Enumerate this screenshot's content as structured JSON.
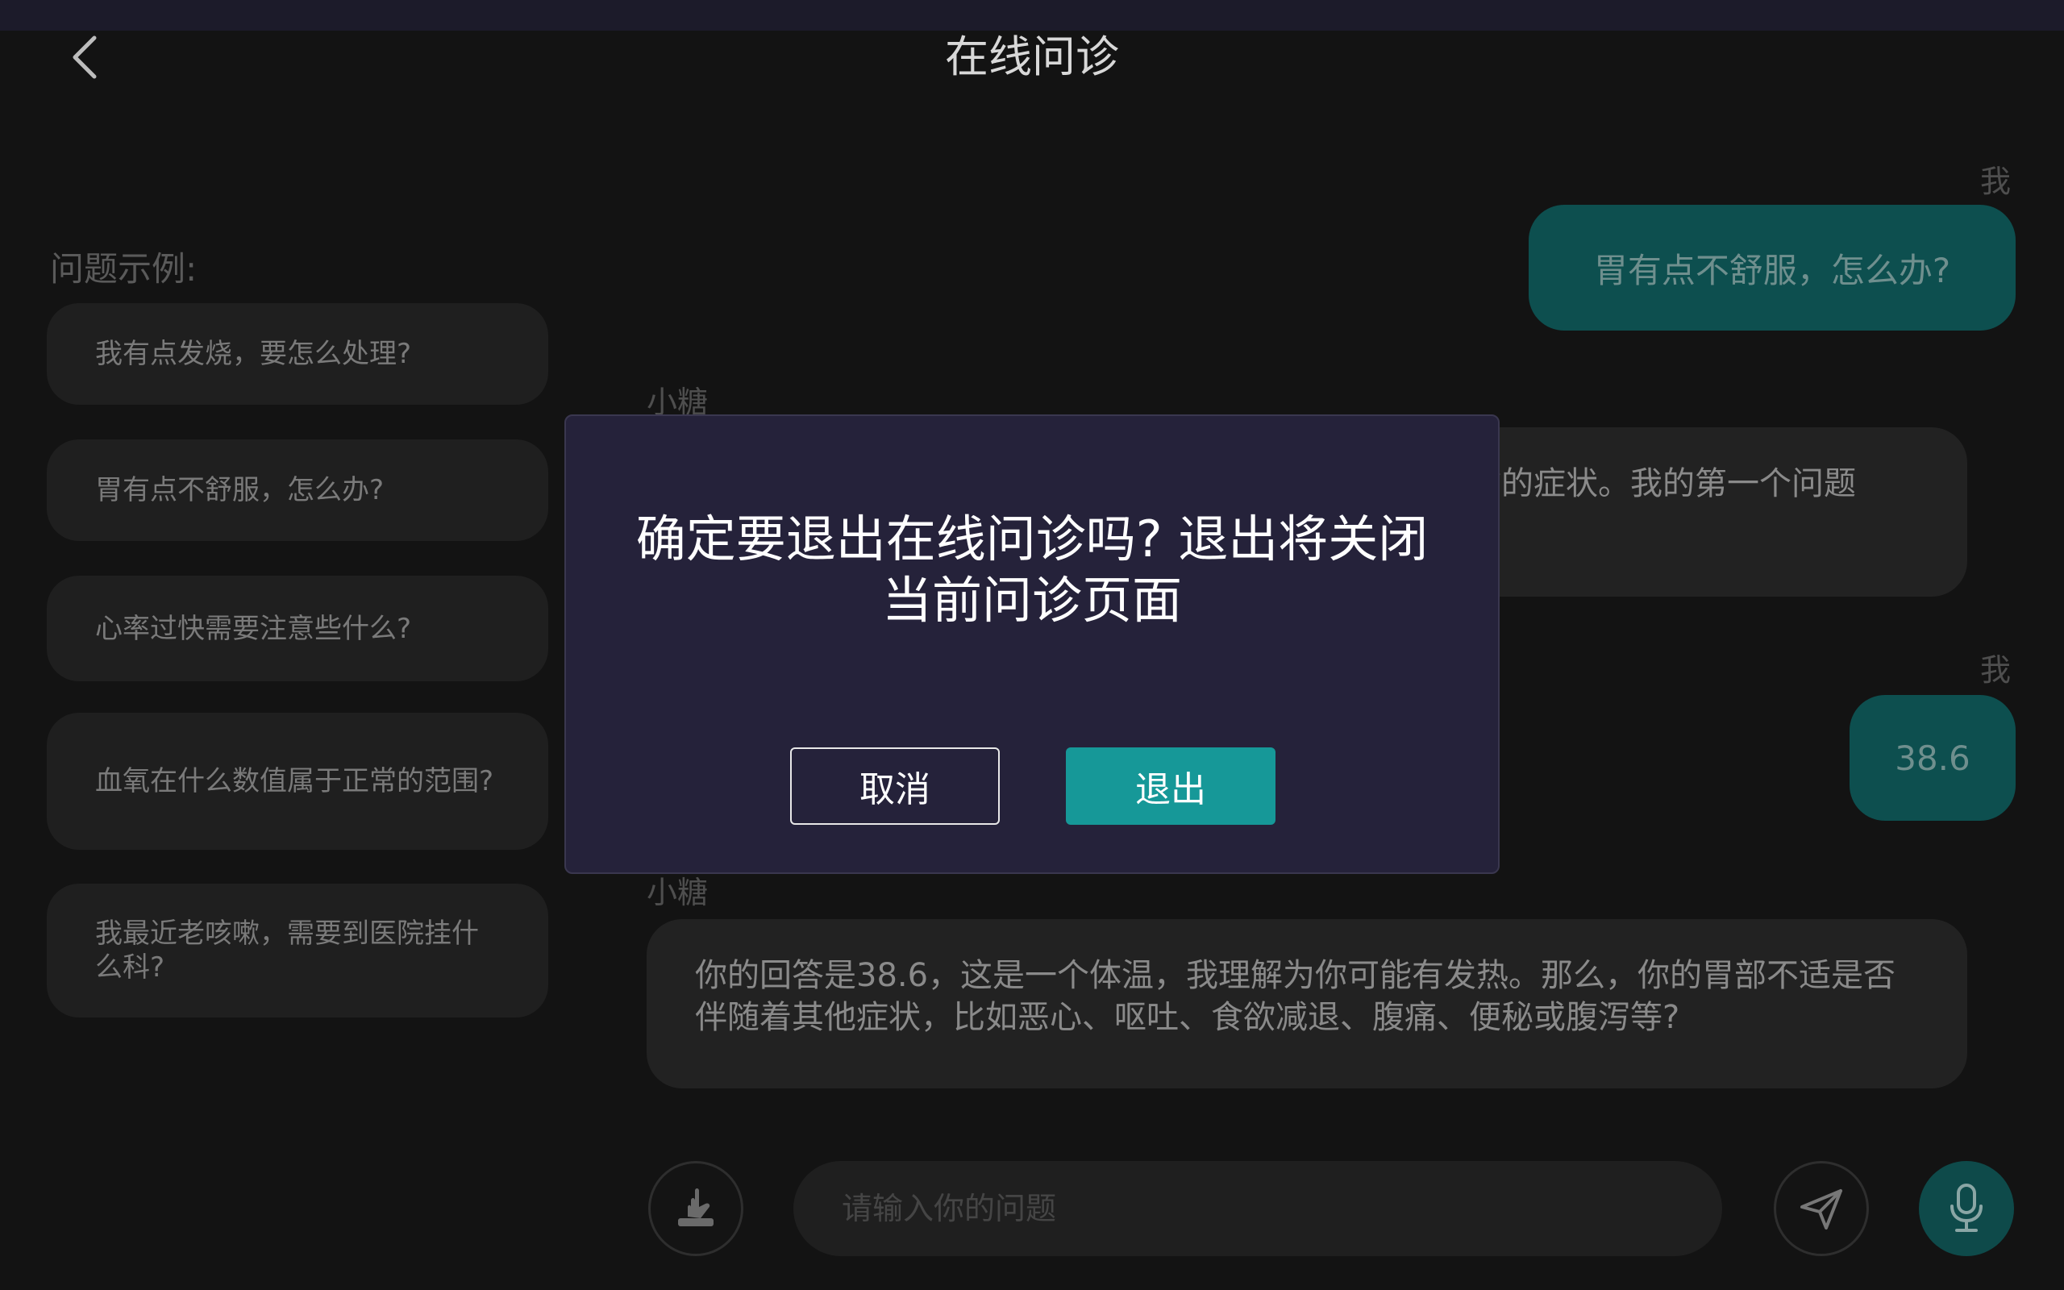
{
  "header": {
    "title": "在线问诊",
    "back_icon": "chevron-left-icon"
  },
  "examples": {
    "title": "问题示例:",
    "items": [
      "我有点发烧，要怎么处理?",
      "胃有点不舒服，怎么办?",
      "心率过快需要注意些什么?",
      "血氧在什么数值属于正常的范围?",
      "我最近老咳嗽，需要到医院挂什么科?"
    ]
  },
  "chat": {
    "me_label": "我",
    "bot_label": "小糖",
    "msg1_me": "胃有点不舒服，怎么办?",
    "msg2_bot": "首先，我需要了解一些更具体的信息以便更准确地判断你的症状。我的第一个问题是：你的体温是多少?",
    "msg3_me": "38.6",
    "msg4_bot": "你的回答是38.6，这是一个体温，我理解为你可能有发热。那么，你的胃部不适是否伴随着其他症状，比如恶心、呕吐、食欲减退、腹痛、便秘或腹泻等?"
  },
  "input": {
    "placeholder": "请输入你的问题",
    "left_icon": "hand-icon",
    "send_icon": "send-icon",
    "mic_icon": "microphone-icon"
  },
  "dialog": {
    "message": "确定要退出在线问诊吗? 退出将关闭当前问诊页面",
    "cancel_label": "取消",
    "exit_label": "退出"
  },
  "colors": {
    "accent": "#169898",
    "dialog_bg": "#25223a",
    "bubble_me": "#0d4f4f"
  }
}
